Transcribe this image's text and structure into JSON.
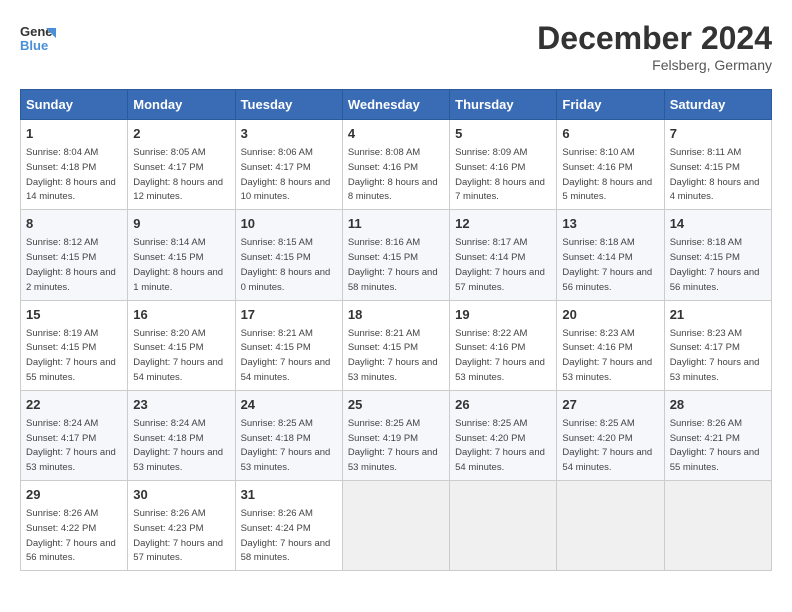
{
  "header": {
    "logo_line1": "General",
    "logo_line2": "Blue",
    "month": "December 2024",
    "location": "Felsberg, Germany"
  },
  "days_of_week": [
    "Sunday",
    "Monday",
    "Tuesday",
    "Wednesday",
    "Thursday",
    "Friday",
    "Saturday"
  ],
  "weeks": [
    [
      {
        "day": "1",
        "sunrise": "8:04 AM",
        "sunset": "4:18 PM",
        "daylight": "8 hours and 14 minutes."
      },
      {
        "day": "2",
        "sunrise": "8:05 AM",
        "sunset": "4:17 PM",
        "daylight": "8 hours and 12 minutes."
      },
      {
        "day": "3",
        "sunrise": "8:06 AM",
        "sunset": "4:17 PM",
        "daylight": "8 hours and 10 minutes."
      },
      {
        "day": "4",
        "sunrise": "8:08 AM",
        "sunset": "4:16 PM",
        "daylight": "8 hours and 8 minutes."
      },
      {
        "day": "5",
        "sunrise": "8:09 AM",
        "sunset": "4:16 PM",
        "daylight": "8 hours and 7 minutes."
      },
      {
        "day": "6",
        "sunrise": "8:10 AM",
        "sunset": "4:16 PM",
        "daylight": "8 hours and 5 minutes."
      },
      {
        "day": "7",
        "sunrise": "8:11 AM",
        "sunset": "4:15 PM",
        "daylight": "8 hours and 4 minutes."
      }
    ],
    [
      {
        "day": "8",
        "sunrise": "8:12 AM",
        "sunset": "4:15 PM",
        "daylight": "8 hours and 2 minutes."
      },
      {
        "day": "9",
        "sunrise": "8:14 AM",
        "sunset": "4:15 PM",
        "daylight": "8 hours and 1 minute."
      },
      {
        "day": "10",
        "sunrise": "8:15 AM",
        "sunset": "4:15 PM",
        "daylight": "8 hours and 0 minutes."
      },
      {
        "day": "11",
        "sunrise": "8:16 AM",
        "sunset": "4:15 PM",
        "daylight": "7 hours and 58 minutes."
      },
      {
        "day": "12",
        "sunrise": "8:17 AM",
        "sunset": "4:14 PM",
        "daylight": "7 hours and 57 minutes."
      },
      {
        "day": "13",
        "sunrise": "8:18 AM",
        "sunset": "4:14 PM",
        "daylight": "7 hours and 56 minutes."
      },
      {
        "day": "14",
        "sunrise": "8:18 AM",
        "sunset": "4:15 PM",
        "daylight": "7 hours and 56 minutes."
      }
    ],
    [
      {
        "day": "15",
        "sunrise": "8:19 AM",
        "sunset": "4:15 PM",
        "daylight": "7 hours and 55 minutes."
      },
      {
        "day": "16",
        "sunrise": "8:20 AM",
        "sunset": "4:15 PM",
        "daylight": "7 hours and 54 minutes."
      },
      {
        "day": "17",
        "sunrise": "8:21 AM",
        "sunset": "4:15 PM",
        "daylight": "7 hours and 54 minutes."
      },
      {
        "day": "18",
        "sunrise": "8:21 AM",
        "sunset": "4:15 PM",
        "daylight": "7 hours and 53 minutes."
      },
      {
        "day": "19",
        "sunrise": "8:22 AM",
        "sunset": "4:16 PM",
        "daylight": "7 hours and 53 minutes."
      },
      {
        "day": "20",
        "sunrise": "8:23 AM",
        "sunset": "4:16 PM",
        "daylight": "7 hours and 53 minutes."
      },
      {
        "day": "21",
        "sunrise": "8:23 AM",
        "sunset": "4:17 PM",
        "daylight": "7 hours and 53 minutes."
      }
    ],
    [
      {
        "day": "22",
        "sunrise": "8:24 AM",
        "sunset": "4:17 PM",
        "daylight": "7 hours and 53 minutes."
      },
      {
        "day": "23",
        "sunrise": "8:24 AM",
        "sunset": "4:18 PM",
        "daylight": "7 hours and 53 minutes."
      },
      {
        "day": "24",
        "sunrise": "8:25 AM",
        "sunset": "4:18 PM",
        "daylight": "7 hours and 53 minutes."
      },
      {
        "day": "25",
        "sunrise": "8:25 AM",
        "sunset": "4:19 PM",
        "daylight": "7 hours and 53 minutes."
      },
      {
        "day": "26",
        "sunrise": "8:25 AM",
        "sunset": "4:20 PM",
        "daylight": "7 hours and 54 minutes."
      },
      {
        "day": "27",
        "sunrise": "8:25 AM",
        "sunset": "4:20 PM",
        "daylight": "7 hours and 54 minutes."
      },
      {
        "day": "28",
        "sunrise": "8:26 AM",
        "sunset": "4:21 PM",
        "daylight": "7 hours and 55 minutes."
      }
    ],
    [
      {
        "day": "29",
        "sunrise": "8:26 AM",
        "sunset": "4:22 PM",
        "daylight": "7 hours and 56 minutes."
      },
      {
        "day": "30",
        "sunrise": "8:26 AM",
        "sunset": "4:23 PM",
        "daylight": "7 hours and 57 minutes."
      },
      {
        "day": "31",
        "sunrise": "8:26 AM",
        "sunset": "4:24 PM",
        "daylight": "7 hours and 58 minutes."
      },
      null,
      null,
      null,
      null
    ]
  ],
  "labels": {
    "sunrise": "Sunrise:",
    "sunset": "Sunset:",
    "daylight": "Daylight:"
  }
}
